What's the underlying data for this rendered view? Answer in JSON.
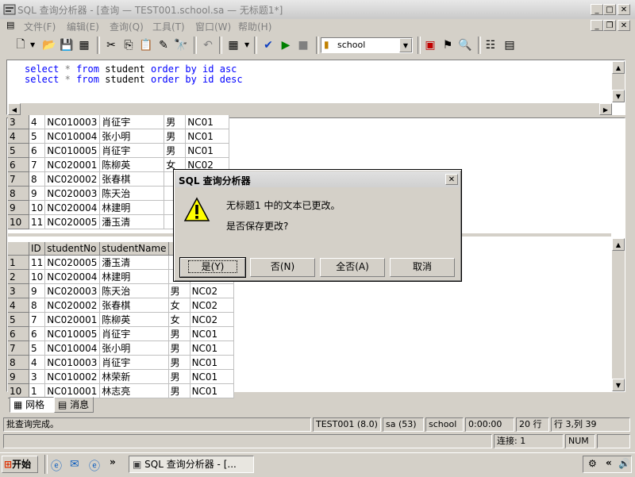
{
  "window": {
    "title": "SQL 查询分析器 - [查询 — TEST001.school.sa — 无标题1*]"
  },
  "menu": [
    "文件(F)",
    "编辑(E)",
    "查询(Q)",
    "工具(T)",
    "窗口(W)",
    "帮助(H)"
  ],
  "toolbar": {
    "database": "school"
  },
  "editor": {
    "line1": [
      "select",
      "*",
      "from",
      "student",
      "order by",
      "id",
      "asc"
    ],
    "line2": [
      "select",
      "*",
      "from",
      "student",
      "order by",
      "id",
      "desc"
    ]
  },
  "grid1": {
    "rows": [
      [
        "4",
        "5",
        "NC010004",
        "张小明",
        "男",
        "NC01"
      ],
      [
        "5",
        "6",
        "NC010005",
        "肖征宇",
        "男",
        "NC01"
      ],
      [
        "6",
        "7",
        "NC020001",
        "陈柳英",
        "女",
        "NC02"
      ],
      [
        "7",
        "8",
        "NC020002",
        "张春棋",
        "",
        ""
      ],
      [
        "8",
        "9",
        "NC020003",
        "陈天治",
        "",
        ""
      ],
      [
        "9",
        "10",
        "NC020004",
        "林建明",
        "",
        ""
      ],
      [
        "10",
        "11",
        "NC020005",
        "潘玉清",
        "",
        ""
      ]
    ]
  },
  "grid2": {
    "headers": [
      "ID",
      "studentNo",
      "studentName"
    ],
    "rows": [
      [
        "1",
        "11",
        "NC020005",
        "潘玉清",
        "",
        ""
      ],
      [
        "2",
        "10",
        "NC020004",
        "林建明",
        "",
        ""
      ],
      [
        "3",
        "9",
        "NC020003",
        "陈天治",
        "男",
        "NC02"
      ],
      [
        "4",
        "8",
        "NC020002",
        "张春棋",
        "女",
        "NC02"
      ],
      [
        "5",
        "7",
        "NC020001",
        "陈柳英",
        "女",
        "NC02"
      ],
      [
        "6",
        "6",
        "NC010005",
        "肖征宇",
        "男",
        "NC01"
      ],
      [
        "7",
        "5",
        "NC010004",
        "张小明",
        "男",
        "NC01"
      ],
      [
        "8",
        "4",
        "NC010003",
        "肖征宇",
        "男",
        "NC01"
      ],
      [
        "9",
        "3",
        "NC010002",
        "林荣新",
        "男",
        "NC01"
      ],
      [
        "10",
        "1",
        "NC010001",
        "林志亮",
        "男",
        "NC01"
      ]
    ]
  },
  "dialog": {
    "title": "SQL 查询分析器",
    "message1": "无标题1 中的文本已更改。",
    "message2": "是否保存更改?",
    "buttons": {
      "yes": "是(Y)",
      "no": "否(N)",
      "no_all": "全否(A)",
      "cancel": "取消"
    }
  },
  "tabs": {
    "grid": "网格",
    "messages": "消息"
  },
  "status": {
    "message": "批查询完成。",
    "server": "TEST001 (8.0)",
    "user": "sa (53)",
    "db": "school",
    "time": "0:00:00",
    "rows": "20 行",
    "position": "行 3,列 39",
    "connections": "连接: 1",
    "num": "NUM"
  },
  "taskbar": {
    "start": "开始",
    "task": "SQL 查询分析器 - [..."
  },
  "colors": {
    "keyword": "#0000ff",
    "selection": "#0a246a"
  }
}
